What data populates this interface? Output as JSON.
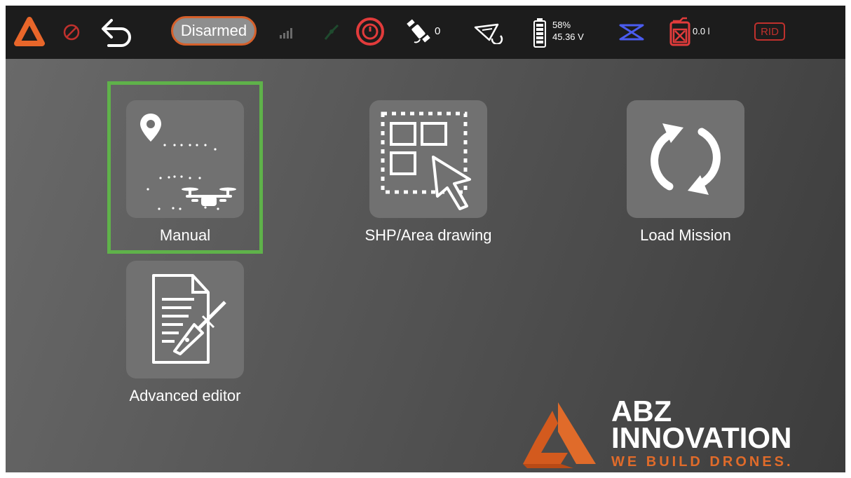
{
  "topbar": {
    "icons": [
      "app-logo-icon",
      "no-entry-icon",
      "back-arrow-icon",
      "signal-bars-icon",
      "link-icon",
      "alert-timer-icon",
      "satellite-icon",
      "drone-mode-icon",
      "battery-icon",
      "flight-mode-icon",
      "fuel-icon"
    ],
    "status": "Disarmed",
    "satellite_count": "0",
    "battery_percent": "58%",
    "battery_voltage": "45.36 V",
    "fuel_level": "0.0 l",
    "rid_label": "RID"
  },
  "menu": {
    "items": [
      {
        "label": "Manual",
        "icon": "map-pin-drone-icon",
        "selected": true
      },
      {
        "label": "SHP/Area drawing",
        "icon": "area-select-icon",
        "selected": false
      },
      {
        "label": "Load Mission",
        "icon": "refresh-icon",
        "selected": false
      },
      {
        "label": "Advanced editor",
        "icon": "document-pen-icon",
        "selected": false
      }
    ]
  },
  "brand": {
    "line1": "ABZ",
    "line2": "INNOVATION",
    "tagline": "WE BUILD DRONES.",
    "accent_color": "#e06b2a"
  }
}
